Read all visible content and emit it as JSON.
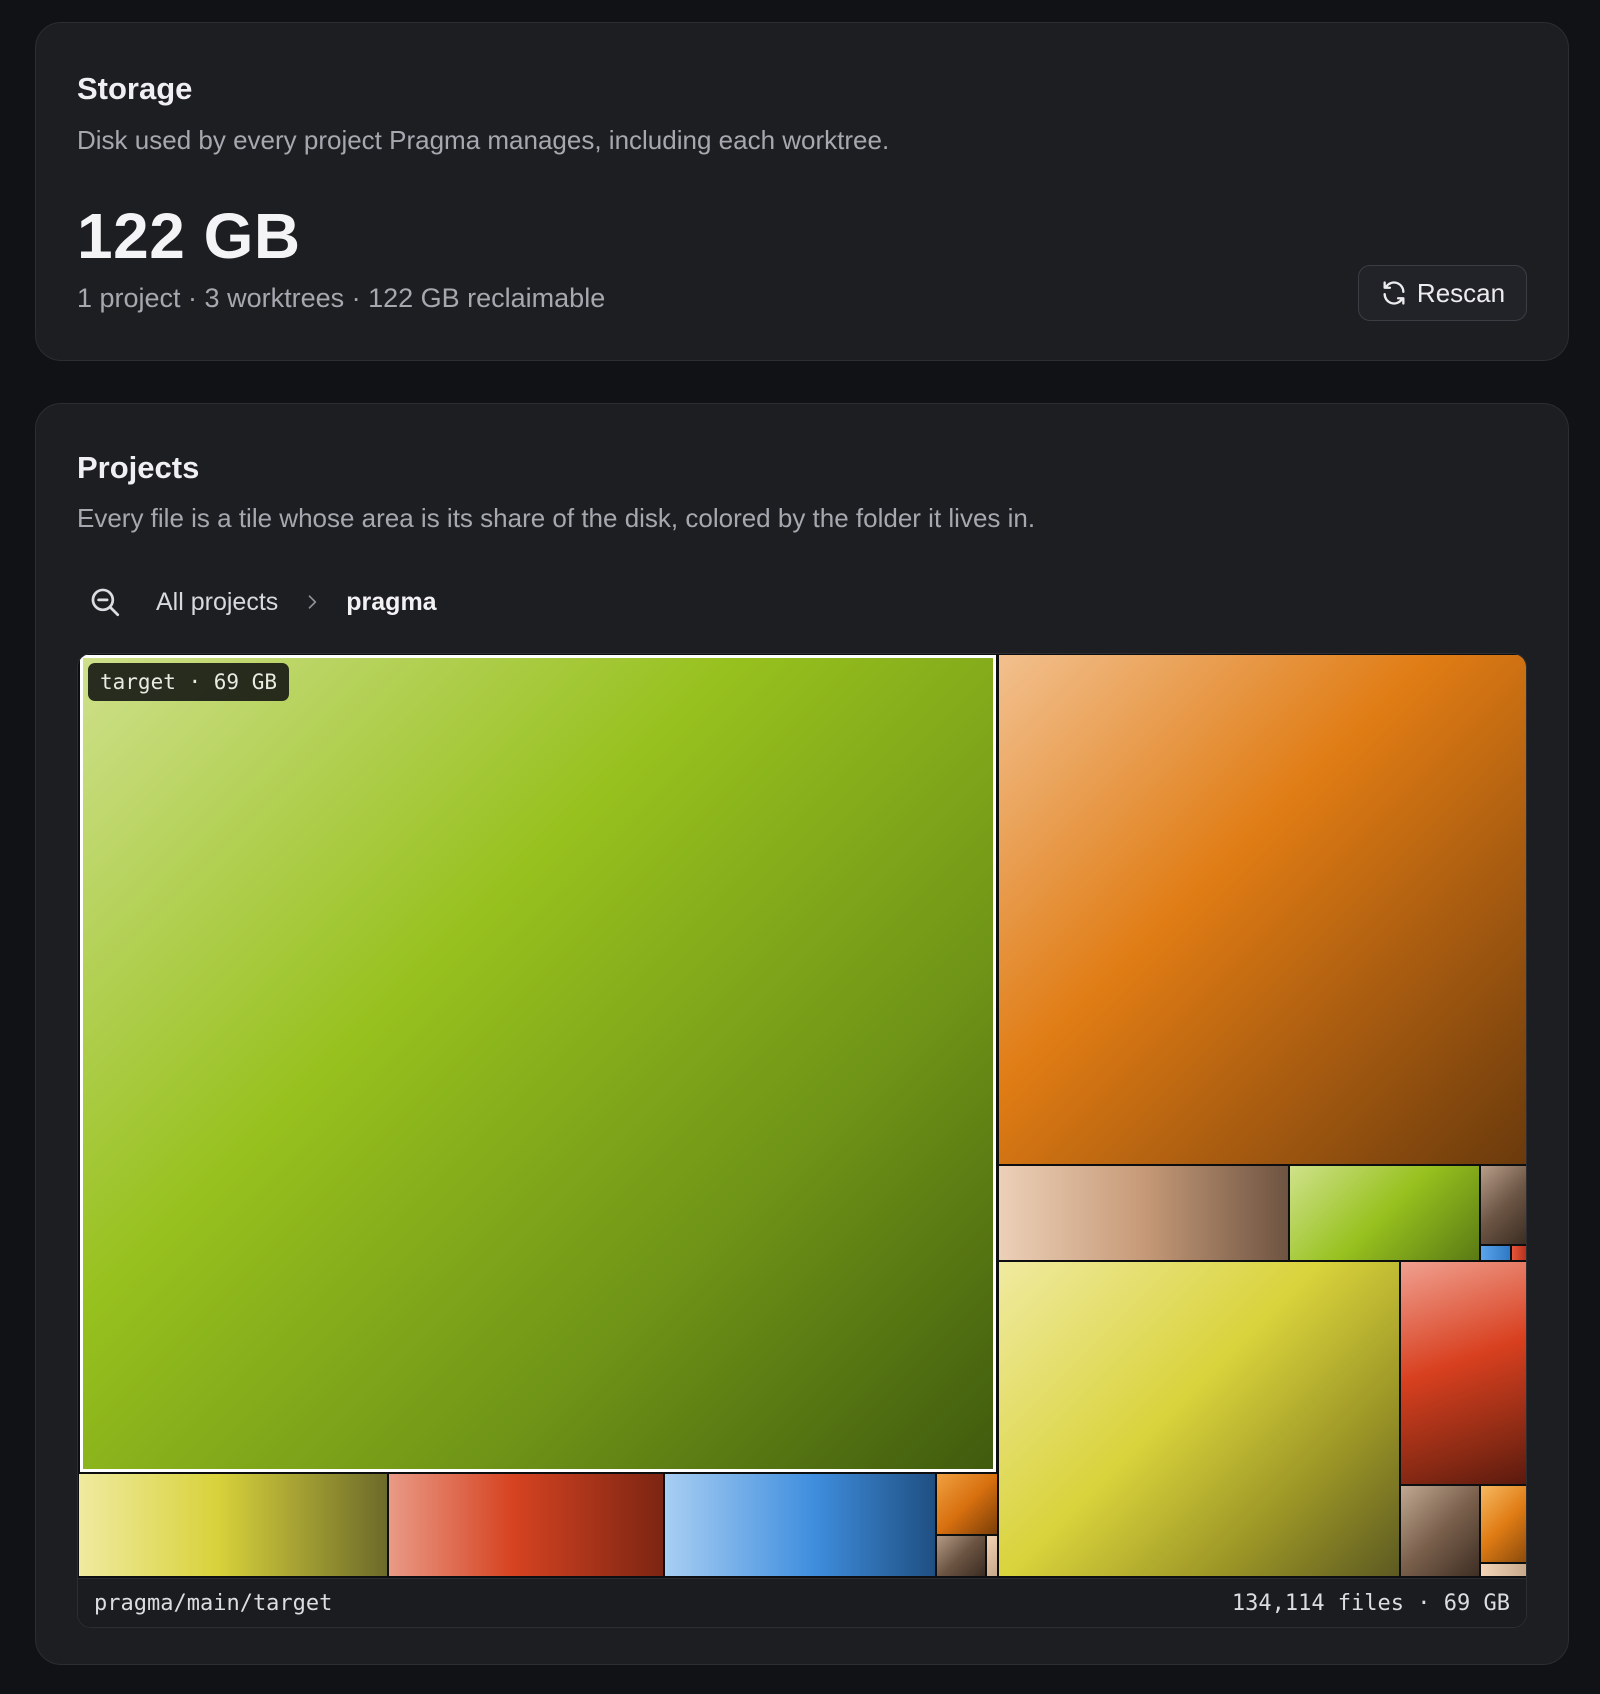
{
  "storage": {
    "title": "Storage",
    "subtitle": "Disk used by every project Pragma manages, including each worktree.",
    "total": "122 GB",
    "summary": "1 project · 3 worktrees · 122 GB reclaimable",
    "rescan_label": "Rescan",
    "rescan_icon": "refresh-icon"
  },
  "projects": {
    "title": "Projects",
    "subtitle": "Every file is a tile whose area is its share of the disk, colored by the folder it lives in.",
    "zoom_icon": "zoom-out-icon",
    "breadcrumb": {
      "root": "All projects",
      "current": "pragma"
    },
    "treemap": {
      "highlight_label": "target · 69 GB",
      "footer_path": "pragma/main/target",
      "footer_stats": "134,114 files · 69 GB",
      "folder_colors": {
        "green": "#97c11e",
        "orange": "#e07c14",
        "tan": "#c8a88a",
        "yellow": "#d6d33a",
        "red": "#d8401f",
        "blue": "#3f8ede",
        "brown": "#7a604c"
      }
    }
  }
}
